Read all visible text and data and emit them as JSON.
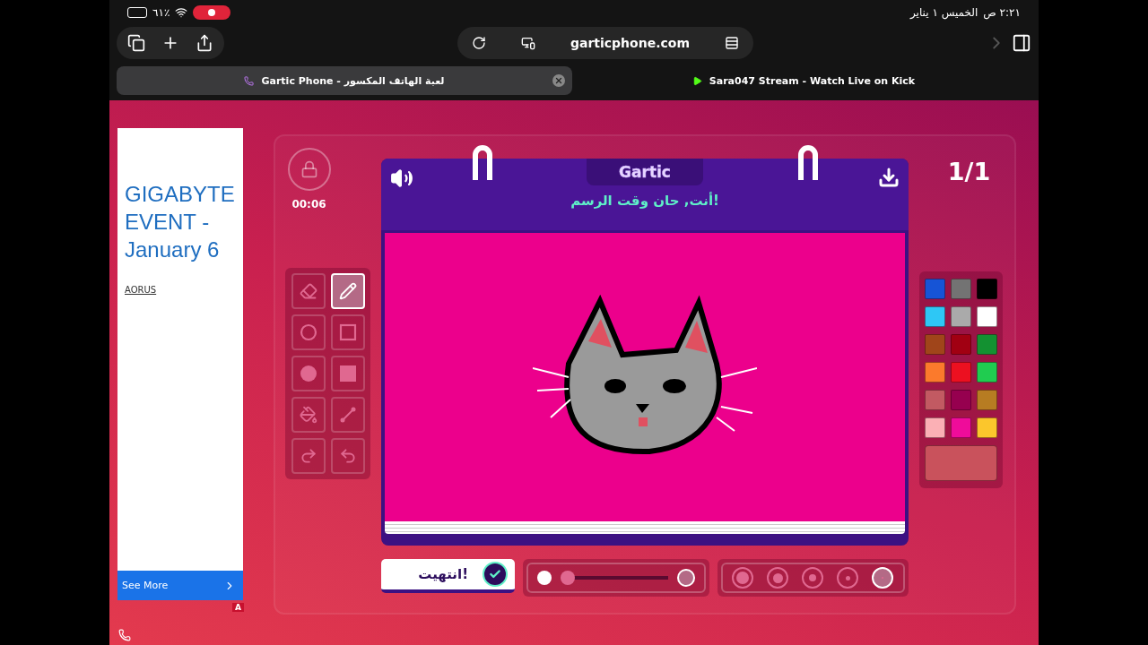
{
  "status_bar": {
    "time": "٢:٢١ ص",
    "date": "الخميس ١ يناير",
    "battery": "٦١٪"
  },
  "browser": {
    "url": "garticphone.com",
    "tabs": [
      {
        "title": "Sara047 Stream - Watch Live on Kick",
        "selected": false
      },
      {
        "title": "Gartic Phone - لعبة الهاتف المكسور",
        "selected": true
      }
    ]
  },
  "ad": {
    "headline": "GIGABYTE EVENT - January 6",
    "brand": "AORUS",
    "cta": "See More",
    "badge": "A"
  },
  "game": {
    "timer": "00:06",
    "round": "1/1",
    "logo": "Gartic",
    "prompt": "أنت, حان وقت الرسم!",
    "done_button": "انتهيت!",
    "tools": [
      {
        "kind": "eraser",
        "selected": false
      },
      {
        "kind": "pencil",
        "selected": true
      },
      {
        "kind": "circle",
        "selected": false
      },
      {
        "kind": "square",
        "selected": false
      },
      {
        "kind": "disc",
        "selected": false
      },
      {
        "kind": "block",
        "selected": false
      },
      {
        "kind": "bucket",
        "selected": false
      },
      {
        "kind": "line",
        "selected": false
      },
      {
        "kind": "redo",
        "selected": false
      },
      {
        "kind": "undo",
        "selected": false
      }
    ],
    "colors": [
      {
        "color": "#1654d6"
      },
      {
        "color": "#737373"
      },
      {
        "color": "#000000"
      },
      {
        "color": "#2ec7f5"
      },
      {
        "color": "#aaaaaa"
      },
      {
        "color": "#ffffff"
      },
      {
        "color": "#a0451a"
      },
      {
        "color": "#a10012"
      },
      {
        "color": "#139131"
      },
      {
        "color": "#fb7a2c"
      },
      {
        "color": "#ec1020"
      },
      {
        "color": "#20cc50"
      },
      {
        "color": "#c25a62"
      },
      {
        "color": "#96004f"
      },
      {
        "color": "#b77c22"
      },
      {
        "color": "#fbb0b5"
      },
      {
        "color": "#ef0c9a"
      },
      {
        "color": "#fbc62c"
      }
    ],
    "current_color": {
      "color": "#c9525c"
    },
    "opacity": {
      "level": 0.0
    },
    "sizes": [
      {
        "selected": false
      },
      {
        "selected": false
      },
      {
        "selected": false
      },
      {
        "selected": false
      },
      {
        "selected": true
      }
    ]
  }
}
